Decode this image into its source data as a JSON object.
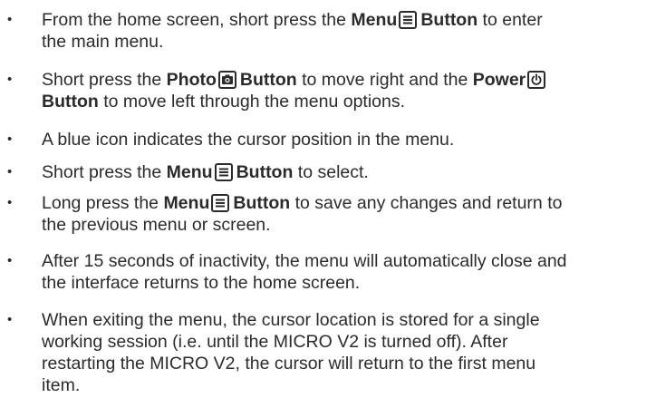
{
  "bullet_glyph": "•",
  "items": [
    {
      "lines": [
        [
          {
            "t": "From the home screen, short press the "
          },
          {
            "t": "Menu",
            "b": true
          },
          {
            "icon": "menu-icon"
          },
          {
            "t": "Button",
            "b": true
          },
          {
            "t": " to enter"
          }
        ],
        [
          {
            "t": "the main menu."
          }
        ]
      ]
    },
    {
      "lines": [
        [
          {
            "t": "Short press the "
          },
          {
            "t": "Photo",
            "b": true
          },
          {
            "icon": "camera-icon"
          },
          {
            "t": "Button",
            "b": true
          },
          {
            "t": " to move right and the "
          },
          {
            "t": "Power",
            "b": true
          },
          {
            "icon": "power-icon"
          }
        ],
        [
          {
            "t": "Button",
            "b": true
          },
          {
            "t": " to move left through the menu options."
          }
        ]
      ]
    },
    {
      "lines": [
        [
          {
            "t": "A blue icon indicates the cursor position in the menu."
          }
        ]
      ]
    },
    {
      "lines": [
        [
          {
            "t": "Short press the "
          },
          {
            "t": "Menu",
            "b": true
          },
          {
            "icon": "menu-icon"
          },
          {
            "t": "Button",
            "b": true
          },
          {
            "t": " to select."
          }
        ]
      ]
    },
    {
      "lines": [
        [
          {
            "t": "Long press the "
          },
          {
            "t": "Menu",
            "b": true
          },
          {
            "icon": "menu-icon"
          },
          {
            "t": "Button",
            "b": true
          },
          {
            "t": " to save any changes and return to"
          }
        ],
        [
          {
            "t": "the previous menu or screen."
          }
        ]
      ]
    },
    {
      "lines": [
        [
          {
            "t": "After 15 seconds of inactivity, the menu will automatically close and"
          }
        ],
        [
          {
            "t": "the interface returns to the home screen."
          }
        ]
      ]
    },
    {
      "lines": [
        [
          {
            "t": "When exiting the menu, the cursor location is stored for a single"
          }
        ],
        [
          {
            "t": "working session (i.e. until the MICRO V2 is turned off). After"
          }
        ],
        [
          {
            "t": "restarting the MICRO V2, the cursor will return to the first menu"
          }
        ],
        [
          {
            "t": "item."
          }
        ]
      ]
    }
  ]
}
